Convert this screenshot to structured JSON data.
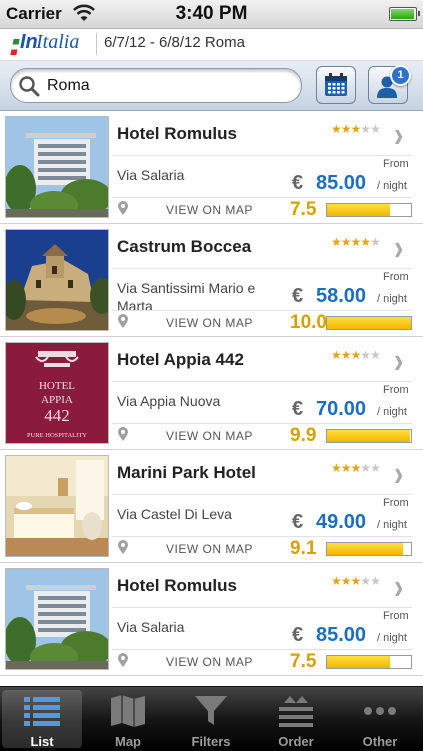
{
  "status_bar": {
    "carrier": "Carrier",
    "time": "3:40 PM"
  },
  "app_bar": {
    "logo_prefix": "In",
    "logo_text": "Italia",
    "trip": "6/7/12 - 6/8/12 Roma"
  },
  "search": {
    "value": "Roma",
    "guest_count": "1"
  },
  "hotels": [
    {
      "name": "Hotel Romulus",
      "stars": 3,
      "address": "Via Salaria",
      "from_label": "From",
      "currency": "€",
      "price": "85.00",
      "per_night": "/ night",
      "map_label": "VIEW ON MAP",
      "score": "7.5",
      "score_fraction": 0.75
    },
    {
      "name": "Castrum Boccea",
      "stars": 4,
      "address": "Via Santissimi Mario e Marta",
      "from_label": "From",
      "currency": "€",
      "price": "58.00",
      "per_night": "/ night",
      "map_label": "VIEW ON MAP",
      "score": "10.0",
      "score_fraction": 1.0
    },
    {
      "name": "Hotel Appia 442",
      "stars": 3,
      "address": "Via Appia Nuova",
      "from_label": "From",
      "currency": "€",
      "price": "70.00",
      "per_night": "/ night",
      "map_label": "VIEW ON MAP",
      "score": "9.9",
      "score_fraction": 0.99,
      "thumb_text": {
        "line1": "HOTEL",
        "line2": "APPIA",
        "line3": "442",
        "tagline": "PURE HOSPITALITY"
      }
    },
    {
      "name": "Marini Park Hotel",
      "stars": 3,
      "address": "Via Castel Di Leva",
      "from_label": "From",
      "currency": "€",
      "price": "49.00",
      "per_night": "/ night",
      "map_label": "VIEW ON MAP",
      "score": "9.1",
      "score_fraction": 0.91
    },
    {
      "name": "Hotel Romulus",
      "stars": 3,
      "address": "Via Salaria",
      "from_label": "From",
      "currency": "€",
      "price": "85.00",
      "per_night": "/ night",
      "map_label": "VIEW ON MAP",
      "score": "7.5",
      "score_fraction": 0.75
    }
  ],
  "tabs": [
    {
      "label": "List",
      "icon": "list-icon",
      "active": true
    },
    {
      "label": "Map",
      "icon": "map-icon",
      "active": false
    },
    {
      "label": "Filters",
      "icon": "filter-icon",
      "active": false
    },
    {
      "label": "Order",
      "icon": "sort-icon",
      "active": false
    },
    {
      "label": "Other",
      "icon": "more-icon",
      "active": false
    }
  ],
  "colors": {
    "price": "#1d6fbd",
    "score": "#d6a100",
    "star": "#e0a51a"
  }
}
